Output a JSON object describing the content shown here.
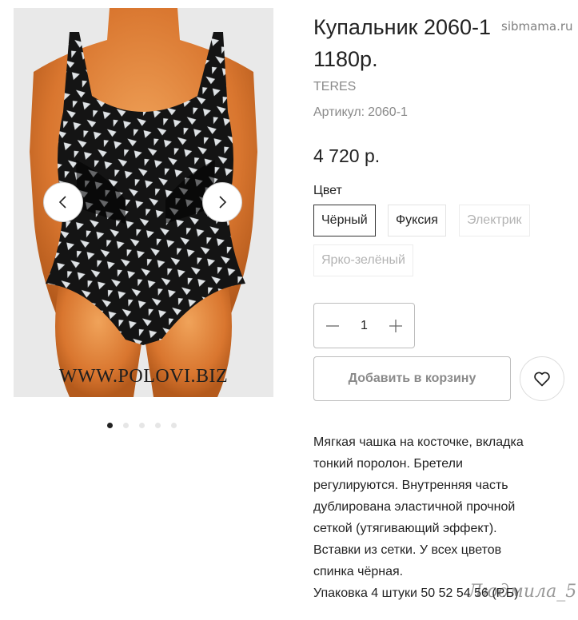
{
  "product": {
    "title_line1": "Купальник 2060-1",
    "title_line2": "1180р.",
    "brand": "TERES",
    "sku_label": "Артикул:",
    "sku_value": "2060-1",
    "price": "4 720 р."
  },
  "gallery": {
    "site_watermark": "WWW.POLOVI.BIZ",
    "slide_count": 5,
    "active_slide": 1,
    "colors": {
      "background": "#e9e9e9",
      "mannequin": "#d9762f",
      "fabric_dark": "#141414",
      "fabric_light": "#dfe3e6"
    }
  },
  "options": {
    "color_label": "Цвет",
    "colors": [
      {
        "label": "Чёрный",
        "state": "selected"
      },
      {
        "label": "Фуксия",
        "state": "available"
      },
      {
        "label": "Электрик",
        "state": "unavailable"
      },
      {
        "label": "Ярко-зелёный",
        "state": "unavailable"
      }
    ]
  },
  "cart": {
    "quantity": "1",
    "add_button": "Добавить в корзину"
  },
  "description": {
    "lines": [
      "Мягкая чашка на косточке, вкладка",
      "тонкий поролон. Бретели",
      "регулируются. Внутренняя часть",
      "дублирована эластичной прочной",
      "сеткой (утягивающий эффект).",
      "Вставки из сетки. У всех цветов",
      "спинка чёрная.",
      "Упаковка 4 штуки 50 52 54 56 (Р.Б)"
    ]
  },
  "overlay_watermarks": {
    "top": "sibmama.ru",
    "bottom": "Людмила_5"
  }
}
